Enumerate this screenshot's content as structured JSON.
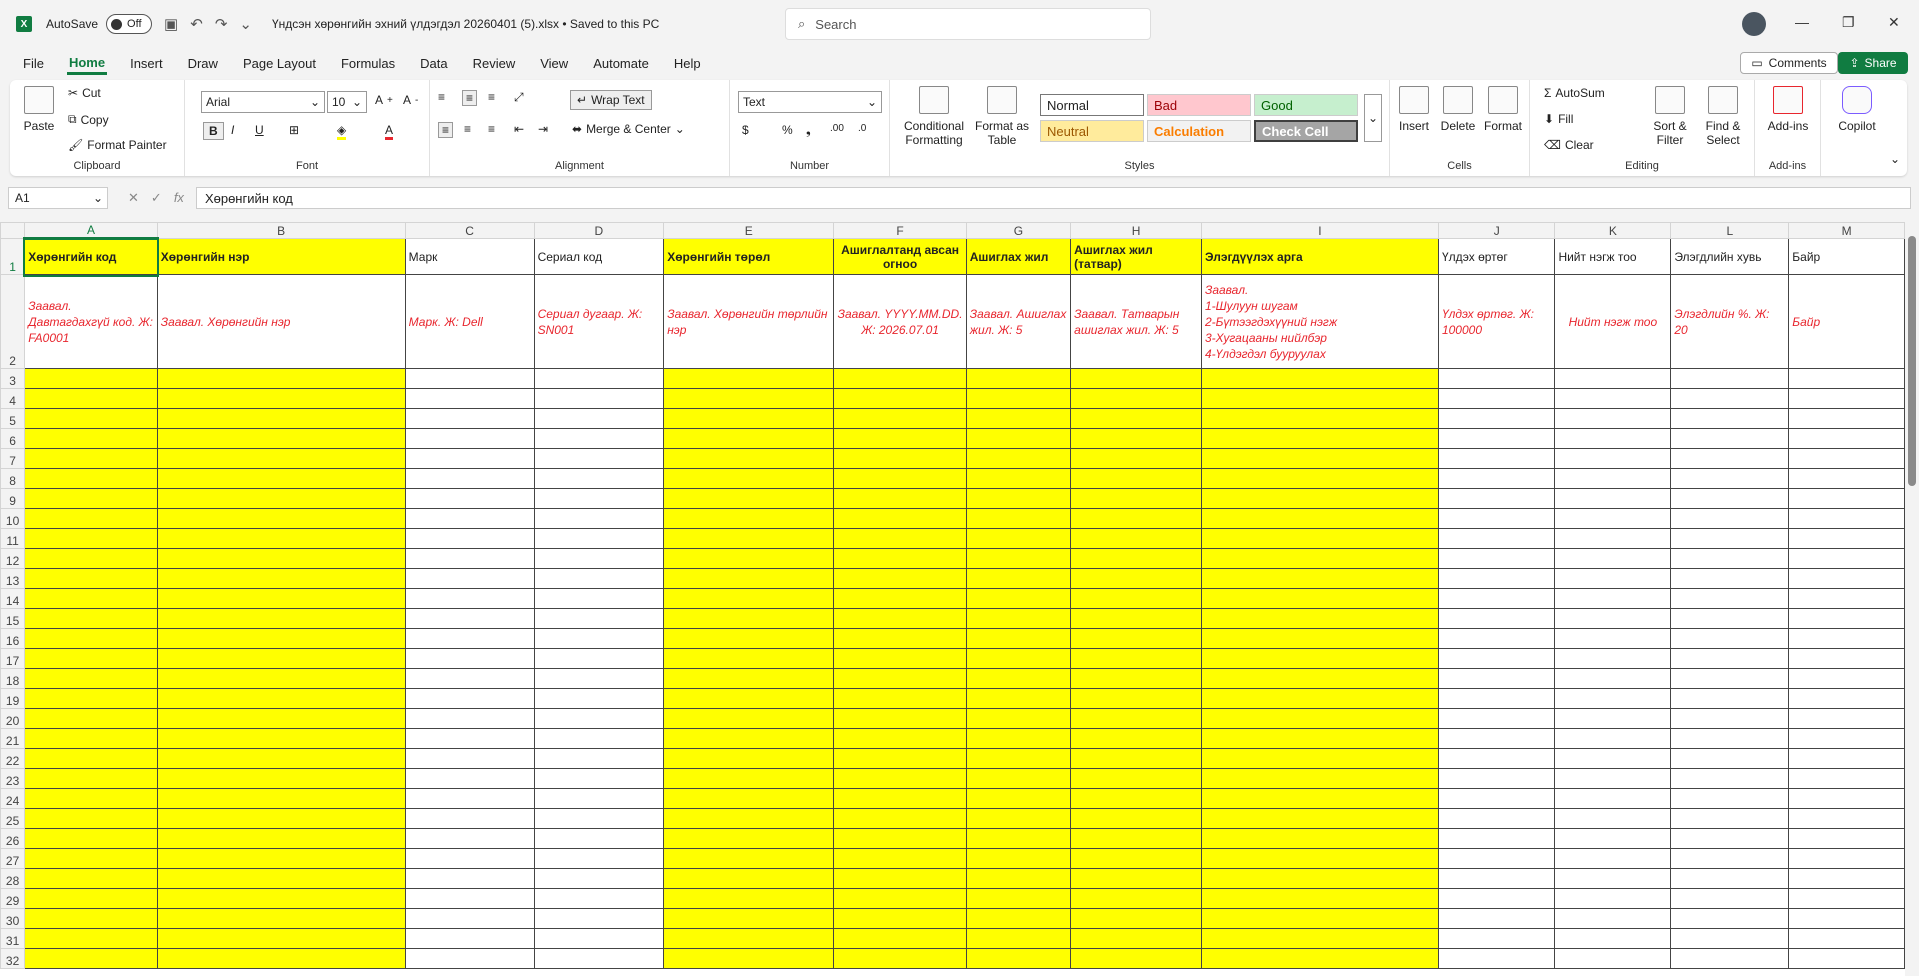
{
  "titlebar": {
    "autosave_label": "AutoSave",
    "autosave_state": "Off",
    "doc_title": "Үндсэн хөрөнгийн эхний үлдэгдэл 20260401 (5).xlsx • Saved to this PC",
    "search_placeholder": "Search"
  },
  "menu": {
    "items": [
      "File",
      "Home",
      "Insert",
      "Draw",
      "Page Layout",
      "Formulas",
      "Data",
      "Review",
      "View",
      "Automate",
      "Help"
    ],
    "active": "Home",
    "comments_label": "Comments",
    "share_label": "Share"
  },
  "ribbon": {
    "clipboard": {
      "paste": "Paste",
      "cut": "Cut",
      "copy": "Copy",
      "format_painter": "Format Painter",
      "label": "Clipboard"
    },
    "font": {
      "name": "Arial",
      "size": "10",
      "label": "Font"
    },
    "alignment": {
      "wrap_text": "Wrap Text",
      "merge_center": "Merge & Center",
      "label": "Alignment"
    },
    "number": {
      "format": "Text",
      "label": "Number"
    },
    "styles": {
      "conditional": "Conditional Formatting",
      "format_table": "Format as Table",
      "normal": "Normal",
      "bad": "Bad",
      "good": "Good",
      "neutral": "Neutral",
      "calculation": "Calculation",
      "check_cell": "Check Cell",
      "label": "Styles"
    },
    "cells": {
      "insert": "Insert",
      "delete": "Delete",
      "format": "Format",
      "label": "Cells"
    },
    "editing": {
      "autosum": "AutoSum",
      "fill": "Fill",
      "clear": "Clear",
      "sort_filter": "Sort & Filter",
      "find_select": "Find & Select",
      "label": "Editing"
    },
    "addins": {
      "addins": "Add-ins",
      "label": "Add-ins"
    },
    "copilot": {
      "label": "Copilot"
    }
  },
  "formula_bar": {
    "name_box": "A1",
    "content": "Хөрөнгийн код"
  },
  "sheet": {
    "columns": [
      "A",
      "B",
      "C",
      "D",
      "E",
      "F",
      "G",
      "H",
      "I",
      "J",
      "K",
      "L",
      "M"
    ],
    "headers": [
      "Хөрөнгийн код",
      "Хөрөнгийн нэр",
      "Марк",
      "Сериал код",
      "Хөрөнгийн төрөл",
      "Ашиглалтанд авсан огноо",
      "Ашиглах жил",
      "Ашиглах жил (татвар)",
      "Элэгдүүлэх арга",
      "Үлдэх өртөг",
      "Нийт нэгж тоо",
      "Элэгдлийн хувь",
      "Байр"
    ],
    "hints": [
      "Заавал. Давтагдахгүй код. Ж: FA0001",
      "Заавал. Хөрөнгийн нэр",
      "Марк. Ж: Dell",
      "Сериал дугаар. Ж: SN001",
      "Заавал. Хөрөнгийн төрлийн нэр",
      "Заавал. YYYY.MM.DD. Ж: 2026.07.01",
      "Заавал. Ашиглах жил. Ж: 5",
      "Заавал. Татварын ашиглах жил. Ж: 5",
      "Заавал.\n1-Шулуун шугам\n2-Бүтээгдэхүүний нэгж\n3-Хугацааны нийлбэр\n4-Үлдэгдэл бууруулах",
      "Үлдэх өртөг. Ж: 100000",
      "Нийт нэгж тоо",
      "Элэгдлийн %. Ж: 20",
      "Байр"
    ],
    "yellow_columns": [
      "A",
      "B",
      "E",
      "F",
      "G",
      "H",
      "I"
    ],
    "row_numbers": [
      "1",
      "2",
      "3",
      "4",
      "5",
      "6",
      "7",
      "8",
      "9",
      "10",
      "11",
      "12",
      "13",
      "14",
      "15",
      "16",
      "17",
      "18",
      "19",
      "20",
      "21",
      "22",
      "23",
      "24",
      "25",
      "26",
      "27",
      "28",
      "29",
      "30",
      "31",
      "32"
    ]
  }
}
